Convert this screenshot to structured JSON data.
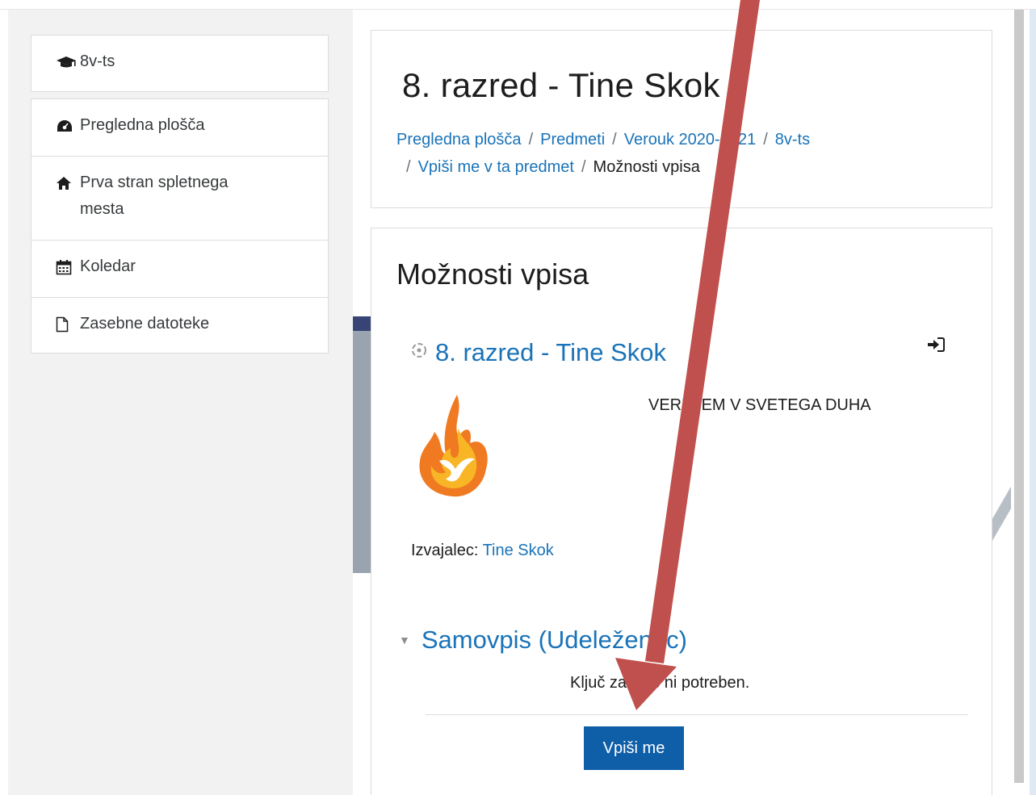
{
  "nav": {
    "top": {
      "label": "8v-ts",
      "icon": "graduation-cap-icon"
    },
    "items": [
      {
        "label": "Pregledna plošča",
        "icon": "dashboard-icon"
      },
      {
        "label": "Prva stran spletnega mesta",
        "icon": "home-icon"
      },
      {
        "label": "Koledar",
        "icon": "calendar-icon"
      },
      {
        "label": "Zasebne datoteke",
        "icon": "file-icon"
      }
    ]
  },
  "header": {
    "title": "8. razred - Tine Skok",
    "breadcrumbs": [
      {
        "label": "Pregledna plošča",
        "link": true
      },
      {
        "label": "Predmeti",
        "link": true
      },
      {
        "label": "Verouk 2020-2021",
        "link": true
      },
      {
        "label": "8v-ts",
        "link": true
      },
      {
        "label": "Vpiši me v ta predmet",
        "link": true
      },
      {
        "label": "Možnosti vpisa",
        "link": false
      }
    ]
  },
  "enrolment": {
    "section_title": "Možnosti vpisa",
    "course_name": "8. razred - Tine Skok",
    "summary": "VERUJEM V SVETEGA DUHA",
    "teacher_label": "Izvajalec:",
    "teacher_name": "Tine Skok",
    "method_title": "Samovpis (Udeleženec)",
    "key_note": "Ključ za vpis ni potreben.",
    "button_label": "Vpiši me"
  },
  "colors": {
    "link": "#1a73b8",
    "button": "#0f5fa8",
    "annotation_arrow": "#c0504d"
  }
}
